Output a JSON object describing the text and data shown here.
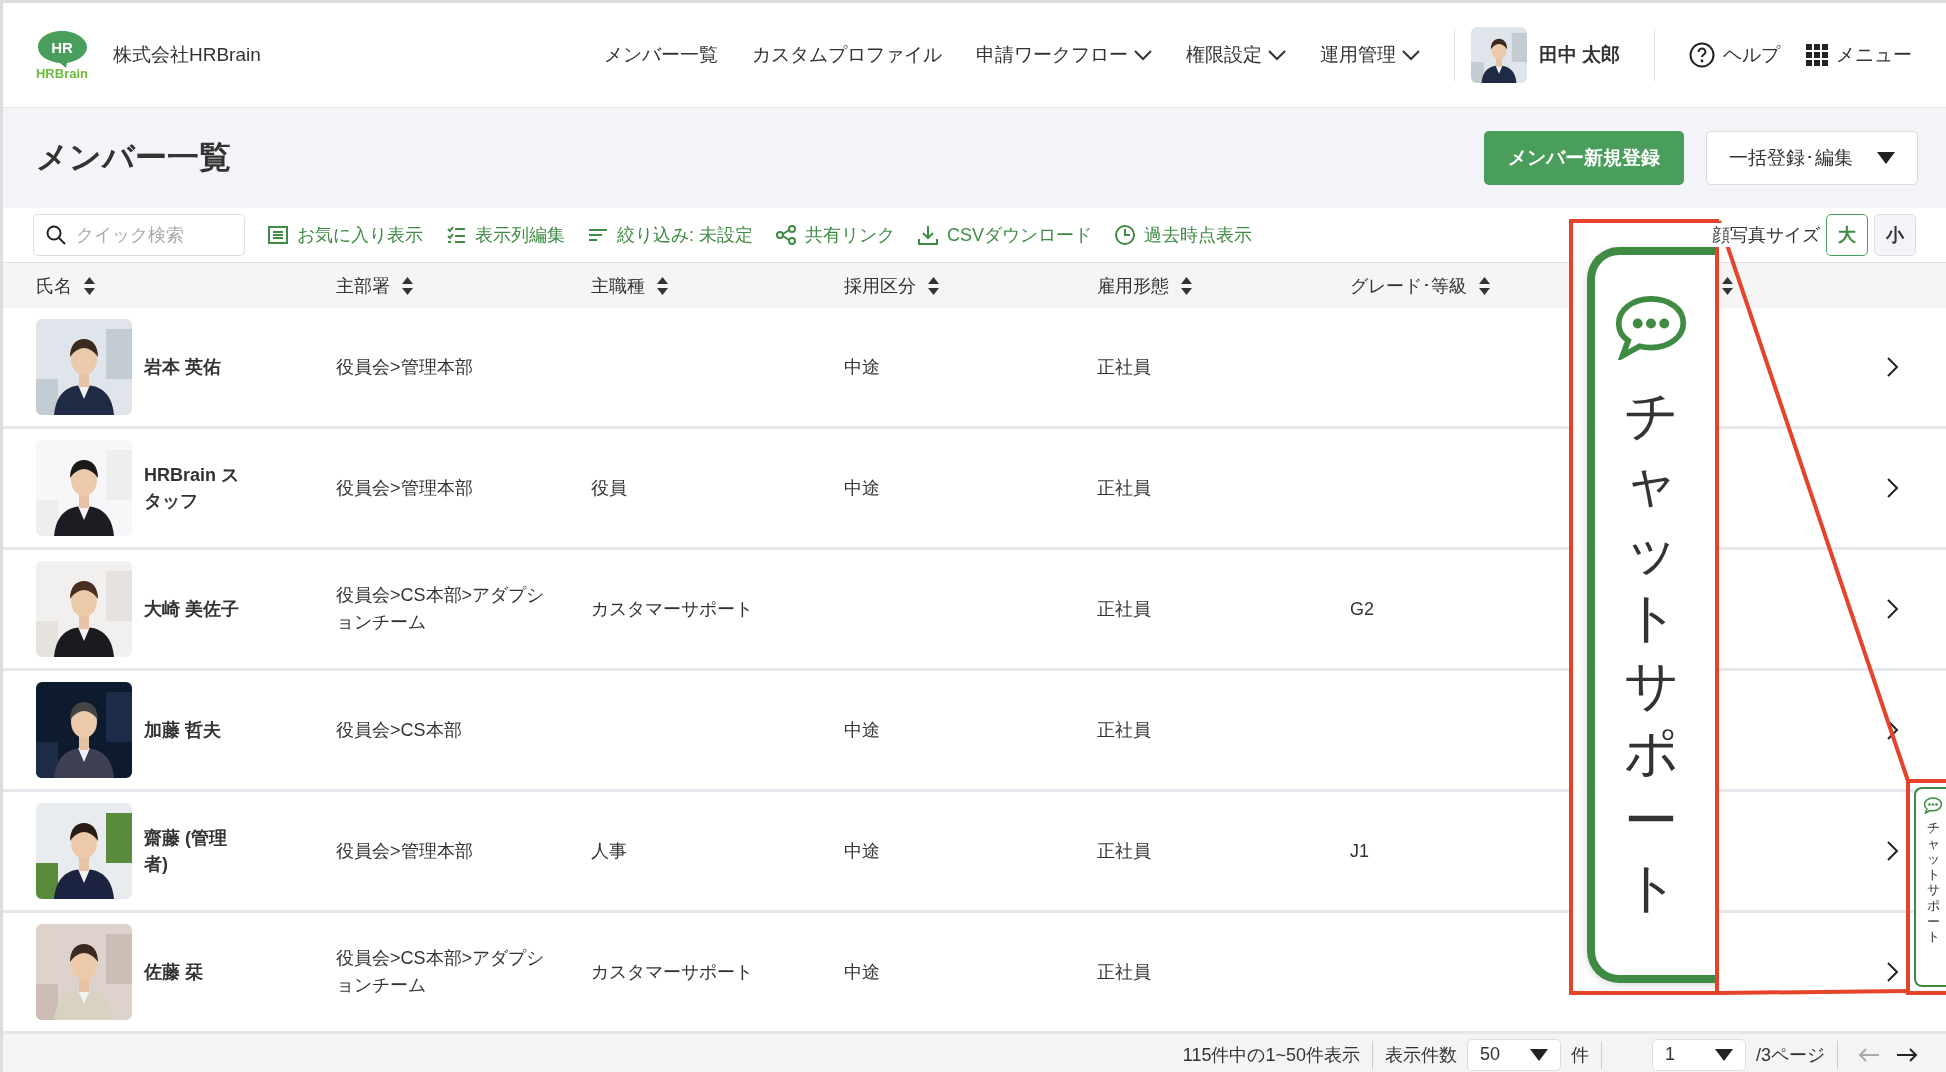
{
  "header": {
    "logo_mark": "HR",
    "logo_word": "HRBrain",
    "company": "株式会社HRBrain",
    "nav": [
      {
        "label": "メンバー一覧",
        "dropdown": false
      },
      {
        "label": "カスタムプロファイル",
        "dropdown": false
      },
      {
        "label": "申請ワークフロー",
        "dropdown": true
      },
      {
        "label": "権限設定",
        "dropdown": true
      },
      {
        "label": "運用管理",
        "dropdown": true
      }
    ],
    "user": {
      "name": "田中 太郎"
    },
    "help": "ヘルプ",
    "menu": "メニュー"
  },
  "page_title": "メンバー一覧",
  "primary_button": "メンバー新規登録",
  "bulk_button": "一括登録･編集",
  "toolbar": {
    "search": {
      "placeholder": "クイック検索"
    },
    "actions": [
      {
        "kind": "favorite",
        "label": "お気に入り表示"
      },
      {
        "kind": "columns",
        "label": "表示列編集"
      },
      {
        "kind": "filter",
        "label": "絞り込み: 未設定"
      },
      {
        "kind": "share",
        "label": "共有リンク"
      },
      {
        "kind": "download",
        "label": "CSVダウンロード"
      },
      {
        "kind": "history",
        "label": "過去時点表示"
      }
    ],
    "photo_size": {
      "label": "顔写真サイズ",
      "options": [
        {
          "label": "大",
          "selected": true
        },
        {
          "label": "小",
          "selected": false
        }
      ]
    }
  },
  "table": {
    "columns": [
      {
        "label": "氏名"
      },
      {
        "label": "主部署"
      },
      {
        "label": "主職種"
      },
      {
        "label": "採用区分"
      },
      {
        "label": "雇用形態"
      },
      {
        "label": "グレード･等級"
      },
      {}
    ],
    "rows": [
      {
        "name": "岩本 英佑",
        "department": "役員会>管理本部",
        "hiring": "中途",
        "employment": "正社員"
      },
      {
        "name": "HRBrain スタッフ",
        "department": "役員会>管理本部",
        "job": "役員",
        "hiring": "中途",
        "employment": "正社員"
      },
      {
        "name": "大崎 美佐子",
        "department": "役員会>CS本部>アダプションチーム",
        "job": "カスタマーサポート",
        "employment": "正社員",
        "grade": "G2"
      },
      {
        "name": "加藤 哲夫",
        "department": "役員会>CS本部",
        "hiring": "中途",
        "employment": "正社員"
      },
      {
        "name": "齋藤 (管理者)",
        "department": "役員会>管理本部",
        "job": "人事",
        "hiring": "中途",
        "employment": "正社員",
        "grade": "J1"
      },
      {
        "name": "佐藤 栞",
        "department": "役員会>CS本部>アダプションチーム",
        "job": "カスタマーサポート",
        "hiring": "中途",
        "employment": "正社員"
      }
    ]
  },
  "footer": {
    "summary": "115件中の1~50件表示",
    "per_page_label": "表示件数",
    "per_page": "50",
    "per_page_unit": "件",
    "page": "1",
    "pages": "/3ページ",
    "prev_disabled": true,
    "next_disabled": false
  },
  "chat_support": {
    "label": "チャットサポート"
  },
  "callout": {
    "label": "チャットサポート"
  }
}
